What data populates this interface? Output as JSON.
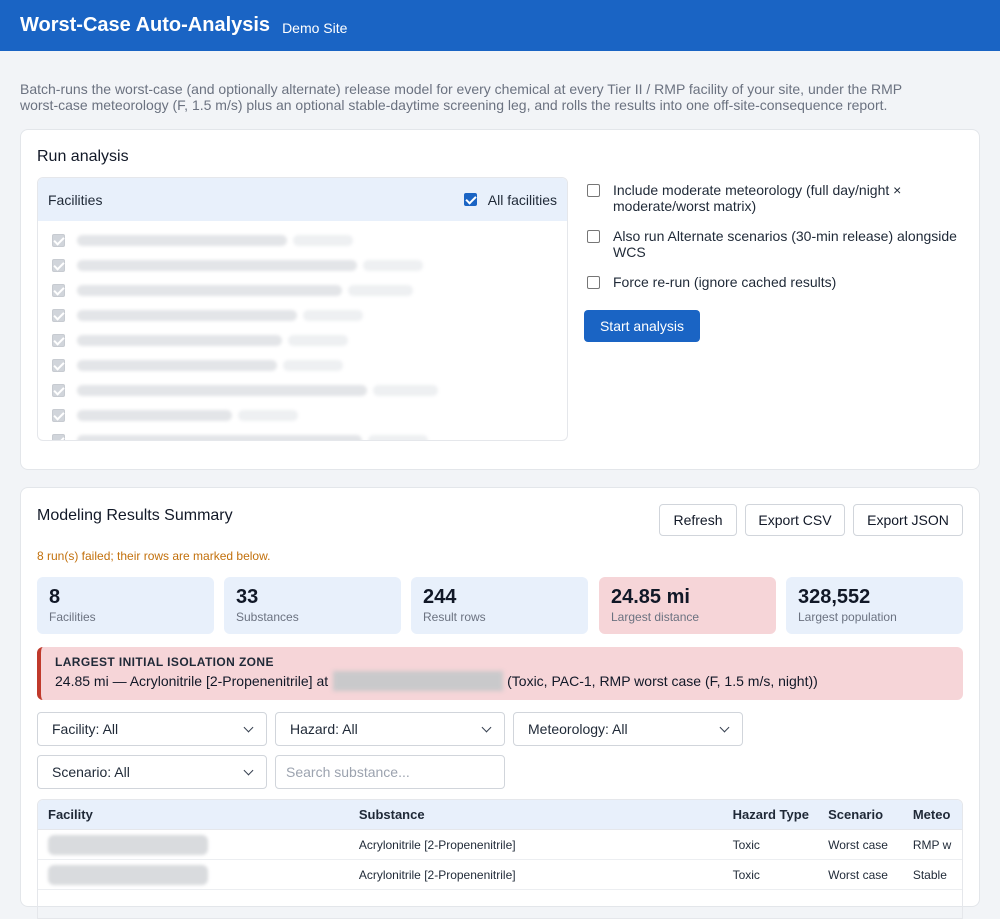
{
  "header": {
    "title": "Worst-Case Auto-Analysis",
    "site": "Demo Site"
  },
  "intro": "Batch-runs the worst-case (and optionally alternate) release model for every chemical at every Tier II / RMP facility of your site, under the RMP worst-case meteorology (F, 1.5 m/s) plus an optional stable-daytime screening leg, and rolls the results into one off-site-consequence report.",
  "run": {
    "title": "Run analysis",
    "facilities_label": "Facilities",
    "all_facilities_label": "All facilities",
    "options": [
      {
        "label": "Include moderate meteorology (full day/night × moderate/worst matrix)",
        "checked": false
      },
      {
        "label": "Also run Alternate scenarios (30-min release) alongside WCS",
        "checked": false
      },
      {
        "label": "Force re-run (ignore cached results)",
        "checked": false
      }
    ],
    "start_label": "Start analysis"
  },
  "results": {
    "title": "Modeling Results Summary",
    "refresh": "Refresh",
    "export_csv": "Export CSV",
    "export_json": "Export JSON",
    "warning": "8 run(s) failed; their rows are marked below.",
    "stats": [
      {
        "value": "8",
        "label": "Facilities"
      },
      {
        "value": "33",
        "label": "Substances"
      },
      {
        "value": "244",
        "label": "Result rows"
      },
      {
        "value": "24.85 mi",
        "label": "Largest distance"
      },
      {
        "value": "328,552",
        "label": "Largest population"
      }
    ],
    "zone": {
      "title": "LARGEST INITIAL ISOLATION ZONE",
      "prefix": "24.85 mi — Acrylonitrile [2-Propenenitrile] at",
      "suffix": "(Toxic, PAC-1, RMP worst case (F, 1.5 m/s, night))"
    },
    "filters": {
      "facility": "Facility: All",
      "hazard": "Hazard: All",
      "meteorology": "Meteorology: All",
      "scenario": "Scenario: All",
      "search_placeholder": "Search substance..."
    },
    "table": {
      "headers": [
        "Facility",
        "Substance",
        "Hazard Type",
        "Scenario",
        "Meteo"
      ],
      "rows": [
        {
          "substance": "Acrylonitrile [2-Propenenitrile]",
          "hazard": "Toxic",
          "scenario": "Worst case",
          "meteo": "RMP w"
        },
        {
          "substance": "Acrylonitrile [2-Propenenitrile]",
          "hazard": "Toxic",
          "scenario": "Worst case",
          "meteo": "Stable"
        }
      ]
    }
  }
}
